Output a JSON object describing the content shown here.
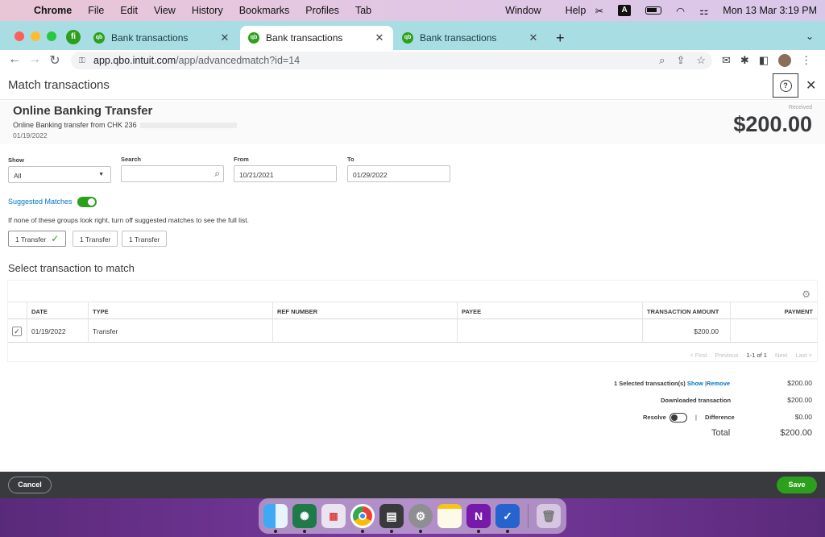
{
  "menubar": {
    "app": "Chrome",
    "items": [
      "File",
      "Edit",
      "View",
      "History",
      "Bookmarks",
      "Profiles",
      "Tab"
    ],
    "right_items": [
      "Window",
      "Help"
    ],
    "input_badge": "A",
    "datetime": "Mon 13 Mar  3:19 PM"
  },
  "tabs": [
    {
      "label": "Bank transactions",
      "active": false
    },
    {
      "label": "Bank transactions",
      "active": true
    },
    {
      "label": "Bank transactions",
      "active": false
    }
  ],
  "address": {
    "host": "app.qbo.intuit.com",
    "path": "/app/advancedmatch?id=14"
  },
  "page": {
    "title": "Match transactions",
    "help_glyph": "?",
    "close_glyph": "✕"
  },
  "transaction": {
    "name": "Online Banking Transfer",
    "description": "Online Banking transfer from CHK 236",
    "date": "01/19/2022",
    "received_label": "Received",
    "amount": "$200.00"
  },
  "filters": {
    "show_label": "Show",
    "show_value": "All",
    "search_label": "Search",
    "search_value": "",
    "from_label": "From",
    "from_value": "10/21/2021",
    "to_label": "To",
    "to_value": "01/29/2022"
  },
  "suggested": {
    "label": "Suggested Matches",
    "enabled": true,
    "hint": "If none of these groups look right, turn off suggested matches to see the full list.",
    "groups": [
      "1 Transfer",
      "1 Transfer",
      "1 Transfer"
    ]
  },
  "table": {
    "section_title": "Select transaction to match",
    "columns": [
      "DATE",
      "TYPE",
      "REF NUMBER",
      "PAYEE",
      "TRANSACTION AMOUNT",
      "PAYMENT"
    ],
    "rows": [
      {
        "checked": true,
        "date": "01/19/2022",
        "type": "Transfer",
        "ref": "",
        "payee": "",
        "amount": "$200.00",
        "payment": ""
      }
    ],
    "pager": {
      "first": "< First",
      "previous": "Previous",
      "range": "1-1 of 1",
      "next": "Next",
      "last": "Last >"
    }
  },
  "summary": {
    "selected_label": "1 Selected transaction(s)",
    "show_link": "Show",
    "separator": "|",
    "remove_link": "Remove",
    "selected_value": "$200.00",
    "downloaded_label": "Downloaded transaction",
    "downloaded_value": "$200.00",
    "resolve_label": "Resolve",
    "difference_label": "Difference",
    "difference_value": "$0.00",
    "total_label": "Total",
    "total_value": "$200.00"
  },
  "footer": {
    "cancel_label": "Cancel",
    "save_label": "Save"
  },
  "colors": {
    "brand_green": "#2ca01c",
    "link_blue": "#0077c5",
    "text": "#393a3d"
  },
  "dock_icons": [
    "finder-icon",
    "chatgpt-icon",
    "launchpad-icon",
    "chrome-icon",
    "calculator-icon",
    "system-settings-icon",
    "notes-icon",
    "onenote-icon",
    "tasks-icon",
    "trash-icon"
  ]
}
